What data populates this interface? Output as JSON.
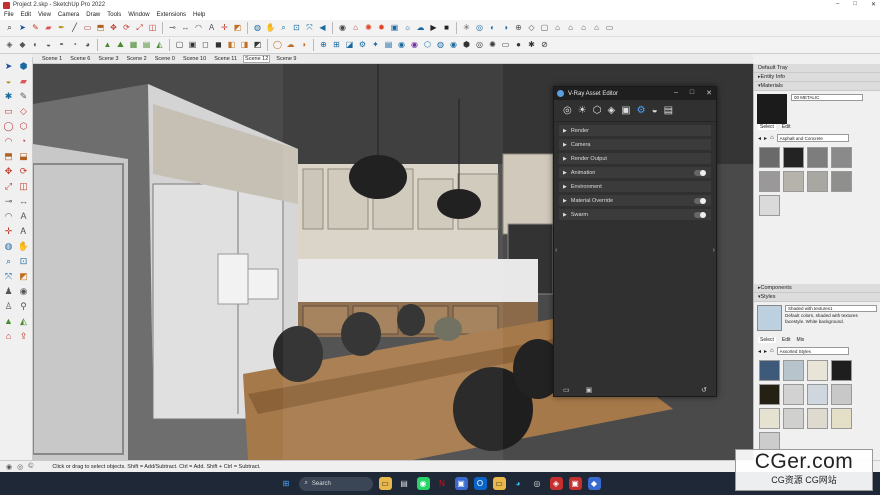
{
  "app": {
    "title": "Project 2.skp - SketchUp Pro 2022"
  },
  "menu": [
    "File",
    "Edit",
    "View",
    "Camera",
    "Draw",
    "Tools",
    "Window",
    "Extensions",
    "Help"
  ],
  "scenes": [
    {
      "label": "Scene 1",
      "active": false
    },
    {
      "label": "Scene 6",
      "active": false
    },
    {
      "label": "Scene 3",
      "active": false
    },
    {
      "label": "Scene 2",
      "active": false
    },
    {
      "label": "Scene 0",
      "active": false
    },
    {
      "label": "Scene 10",
      "active": false
    },
    {
      "label": "Scene 11",
      "active": false
    },
    {
      "label": "Scene 12",
      "active": true
    },
    {
      "label": "Scene 9",
      "active": false
    }
  ],
  "vray": {
    "title": "V-Ray Asset Editor",
    "sections": [
      {
        "label": "Render",
        "toggle": false
      },
      {
        "label": "Camera",
        "toggle": false
      },
      {
        "label": "Render Output",
        "toggle": false
      },
      {
        "label": "Animation",
        "toggle": true
      },
      {
        "label": "Environment",
        "toggle": false
      },
      {
        "label": "Material Override",
        "toggle": true
      },
      {
        "label": "Swarm",
        "toggle": true
      }
    ]
  },
  "tray": {
    "title": "Default Tray",
    "entity_info": "Entity Info",
    "materials": "Materials",
    "material_name": "00 METALIC",
    "select_tab": "Select",
    "edit_tab": "Edit",
    "library": "Asphalt and Concrete",
    "components": "Components",
    "styles": "Styles",
    "style_name": "Shaded with textures1",
    "style_desc": "Default colors, shaded with textures facestyle. White background.",
    "mix_tab": "Mix",
    "style_library": "Assorted Styles",
    "material_swatches": [
      "#6a6a6a",
      "#232323",
      "#7d7d7d",
      "#8a8a8a",
      "#9a9898",
      "#b6b3ad",
      "#a9a7a2",
      "#8f8f8e",
      "#dadada"
    ],
    "style_swatches": [
      "#3d5a7a",
      "#b8c4cc",
      "#e8e4d8",
      "#1e1e1e",
      "#242014",
      "#d2d2d2",
      "#cfd6dd",
      "#c8c8c8",
      "#e6e2d2",
      "#d0d0ce",
      "#dedad0",
      "#e4e0c8",
      "#cccccc"
    ]
  },
  "status": {
    "text": "Click or drag to select objects. Shift = Add/Subtract. Ctrl = Add. Shift + Ctrl = Subtract."
  },
  "taskbar": {
    "search": "Search"
  },
  "watermark": {
    "big": "CGer.com",
    "small": "CG资源  CG网站"
  }
}
